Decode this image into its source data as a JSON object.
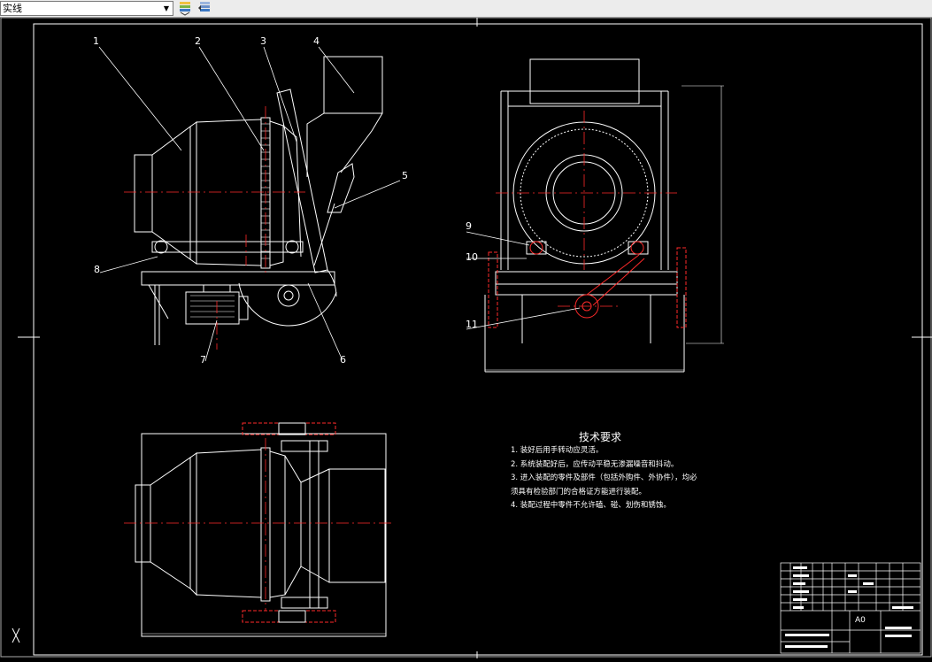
{
  "toolbar": {
    "layer_combo_value": "实线",
    "buttons": [
      {
        "icon": "layer-state-icon"
      },
      {
        "icon": "layer-previous-icon"
      }
    ]
  },
  "drawing": {
    "balloons": [
      "1",
      "2",
      "3",
      "4",
      "5",
      "6",
      "7",
      "8",
      "9",
      "10",
      "11"
    ],
    "technical_requirements": {
      "title": "技术要求",
      "items": [
        "1. 装好后用手转动应灵活。",
        "2. 系统装配好后，应传动平稳无渗漏噪音和抖动。",
        "3. 进入装配的零件及部件（包括外购件、外协件），均必",
        "须具有检验部门的合格证方能进行装配。",
        "4. 装配过程中零件不允许磕、碰、划伤和锈蚀。"
      ]
    },
    "title_block": {
      "sheet_size": "A0"
    }
  },
  "colors": {
    "background": "#000000",
    "line": "#ffffff",
    "center_line": "#ff0000",
    "hidden": "#ff2020"
  }
}
